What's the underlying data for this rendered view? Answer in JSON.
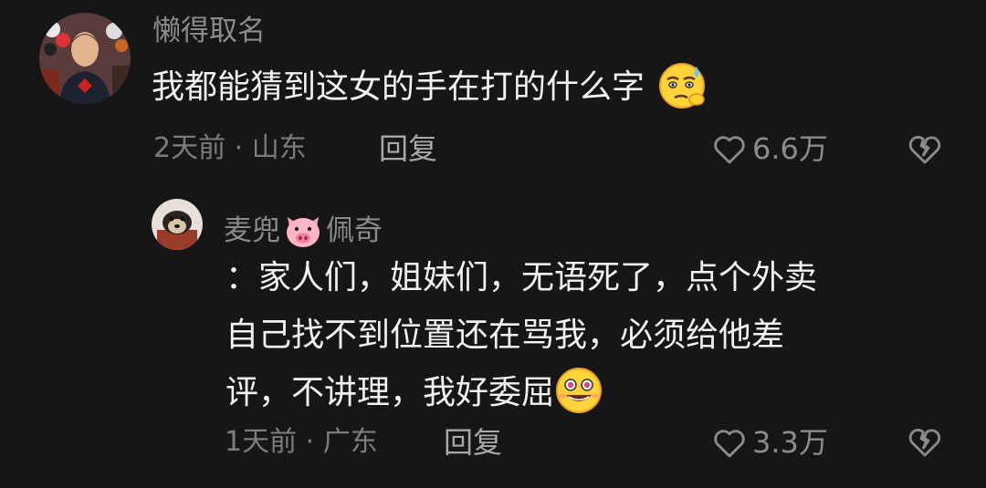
{
  "comment": {
    "username": "懒得取名",
    "text": "我都能猜到这女的手在打的什么字",
    "trailing_emoji": "smug-emoji",
    "time_location": "2天前 · 山东",
    "reply_label": "回复",
    "like_count": "6.6万"
  },
  "reply": {
    "username_part1": "麦兜",
    "username_emoji": "pig-face-emoji",
    "username_part2": "佩奇",
    "text_line1": "：家人们，姐妹们，无语死了，点个外卖",
    "text_line2": "自己找不到位置还在骂我，必须给他差",
    "text_line3": "评，不讲理，我好委屈",
    "trailing_emoji": "grin-emoji",
    "time_location": "1天前 · 广东",
    "reply_label": "回复",
    "like_count": "3.3万"
  },
  "icons": {
    "like": "heart-outline-icon",
    "dislike": "broken-heart-icon"
  },
  "colors": {
    "background": "#161616",
    "primary_text": "#f2f2f2",
    "secondary_text": "#8b8b8b"
  }
}
